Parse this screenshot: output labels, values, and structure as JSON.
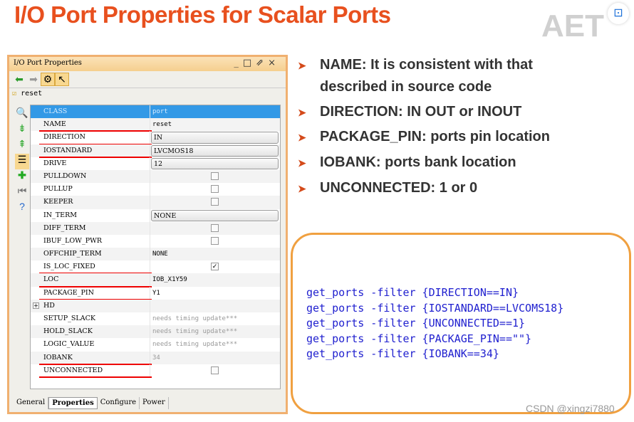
{
  "slide_title": "I/O Port Properties for Scalar Ports",
  "logo": "AET",
  "panel": {
    "title": "I/O Port Properties",
    "object": "reset",
    "rows": [
      {
        "label": "CLASS",
        "value": "port",
        "type": "text",
        "highlight": true
      },
      {
        "label": "NAME",
        "value": "reset",
        "type": "text",
        "underline": true
      },
      {
        "label": "DIRECTION",
        "value": "IN",
        "type": "dropdown",
        "underline": true
      },
      {
        "label": "IOSTANDARD",
        "value": "LVCMOS18",
        "type": "dropdown",
        "underline": true
      },
      {
        "label": "DRIVE",
        "value": "12",
        "type": "dropdown"
      },
      {
        "label": "PULLDOWN",
        "type": "checkbox",
        "checked": false
      },
      {
        "label": "PULLUP",
        "type": "checkbox",
        "checked": false
      },
      {
        "label": "KEEPER",
        "type": "checkbox",
        "checked": false
      },
      {
        "label": "IN_TERM",
        "value": "NONE",
        "type": "dropdown"
      },
      {
        "label": "DIFF_TERM",
        "type": "checkbox",
        "checked": false
      },
      {
        "label": "IBUF_LOW_PWR",
        "type": "checkbox",
        "checked": false
      },
      {
        "label": "OFFCHIP_TERM",
        "value": "NONE",
        "type": "text"
      },
      {
        "label": "IS_LOC_FIXED",
        "type": "checkbox",
        "checked": true,
        "underline": true
      },
      {
        "label": "LOC",
        "value": "IOB_X1Y59",
        "type": "text",
        "underline": true
      },
      {
        "label": "PACKAGE_PIN",
        "value": "Y1",
        "type": "text",
        "underline": true
      },
      {
        "label": "HD",
        "type": "group"
      },
      {
        "label": "SETUP_SLACK",
        "value": "needs timing update***",
        "type": "gray"
      },
      {
        "label": "HOLD_SLACK",
        "value": "needs timing update***",
        "type": "gray"
      },
      {
        "label": "LOGIC_VALUE",
        "value": "needs timing update***",
        "type": "gray"
      },
      {
        "label": "IOBANK",
        "value": "34",
        "type": "gray",
        "underline": true
      },
      {
        "label": "UNCONNECTED",
        "type": "checkbox",
        "checked": false,
        "underline": true
      }
    ],
    "tabs": [
      "General",
      "Properties",
      "Configure",
      "Power"
    ],
    "active_tab": "Properties"
  },
  "bullets": [
    "NAME: It is consistent with that",
    "described in source code",
    "DIRECTION: IN OUT or INOUT",
    "PACKAGE_PIN: ports pin location",
    "IOBANK: ports bank location",
    "UNCONNECTED: 1 or 0"
  ],
  "code": [
    "get_ports -filter {DIRECTION==IN}",
    "get_ports -filter {IOSTANDARD==LVCOMS18}",
    "get_ports -filter {UNCONNECTED==1}",
    "get_ports -filter {PACKAGE_PIN==\"\"}",
    "get_ports -filter {IOBANK==34}"
  ],
  "watermark": "CSDN @xingzi7880",
  "colors": {
    "title": "#e8501e",
    "code": "#1f1fcf",
    "border": "#f0a040",
    "selection": "#3399e6"
  }
}
